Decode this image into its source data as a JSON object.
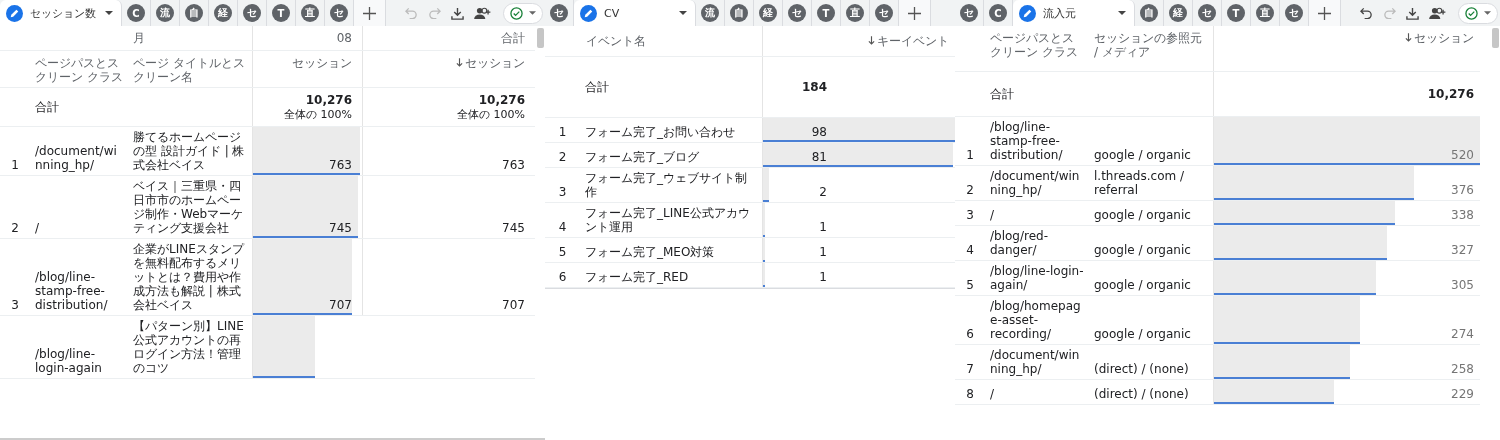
{
  "panels": [
    {
      "tabs": [
        {
          "label": "セッション数",
          "selected": true
        },
        {
          "label": "C",
          "selected": false
        },
        {
          "label": "流",
          "selected": false
        },
        {
          "label": "自",
          "selected": false
        },
        {
          "label": "経",
          "selected": false
        },
        {
          "label": "セ",
          "selected": false
        },
        {
          "label": "T",
          "selected": false
        },
        {
          "label": "直",
          "selected": false
        },
        {
          "label": "セ",
          "selected": false
        }
      ],
      "toolbar": {
        "undo": {
          "disabled": true
        },
        "redo": {
          "disabled": true
        }
      },
      "table": {
        "columns": [
          {
            "heading": "ページパスとスクリーン クラス",
            "kind": "dimension"
          },
          {
            "heading": "ページ タイトルとスクリーン名",
            "kind": "dimension",
            "group": "月"
          },
          {
            "heading": "セッション",
            "kind": "metric",
            "group": "08",
            "sorted": false
          },
          {
            "heading": "セッション",
            "kind": "metric",
            "group": "合計",
            "sorted": true
          }
        ],
        "total": {
          "label": "合計",
          "cells": [
            {
              "value": "10,276",
              "share": "全体の 100%"
            },
            {
              "value": "10,276",
              "share": "全体の 100%"
            }
          ]
        },
        "rows": [
          {
            "index": "1",
            "dims": [
              "/document/winning_hp/",
              "勝てるホームページの型 設計ガイド | 株式会社ベイス"
            ],
            "metrics": [
              {
                "value": "763",
                "level": 0.98
              },
              {
                "value": "763"
              }
            ]
          },
          {
            "index": "2",
            "dims": [
              "/",
              "ベイス｜三重県・四日市市のホームページ制作・Webマーケティング支援会社"
            ],
            "metrics": [
              {
                "value": "745",
                "level": 0.96
              },
              {
                "value": "745"
              }
            ]
          },
          {
            "index": "3",
            "dims": [
              "/blog/line-stamp-free-distribution/",
              "企業がLINEスタンプを無料配布するメリットとは？費用や作成方法も解説 | 株式会社ベイス"
            ],
            "metrics": [
              {
                "value": "707",
                "level": 0.91
              },
              {
                "value": "707"
              }
            ]
          },
          {
            "dims": [
              "/blog/line-login-again",
              "【パターン別】LINE公式アカウントの再ログイン方法！管理のコツ"
            ],
            "metrics": [
              {
                "level": 0.57
              }
            ]
          }
        ]
      }
    },
    {
      "tabs": [
        {
          "label": "セ",
          "selected": false
        },
        {
          "label": "CV",
          "selected": true
        },
        {
          "label": "流",
          "selected": false
        },
        {
          "label": "自",
          "selected": false
        },
        {
          "label": "経",
          "selected": false
        },
        {
          "label": "セ",
          "selected": false
        },
        {
          "label": "T",
          "selected": false
        },
        {
          "label": "直",
          "selected": false
        },
        {
          "label": "セ",
          "selected": false
        }
      ],
      "table": {
        "columns": [
          {
            "heading": "イベント名",
            "kind": "dimension"
          },
          {
            "heading": "キーイベント",
            "kind": "metric",
            "sorted": true
          }
        ],
        "total": {
          "label": "合計",
          "cells": [
            {
              "value": "184"
            }
          ]
        },
        "rows": [
          {
            "index": "1",
            "dims": [
              "フォーム完了_お問い合わせ"
            ],
            "metrics": [
              {
                "value": "98",
                "level": 1
              }
            ]
          },
          {
            "index": "2",
            "dims": [
              "フォーム完了_ブログ"
            ],
            "metrics": [
              {
                "value": "81",
                "level": 0.99
              }
            ]
          },
          {
            "index": "3",
            "dims": [
              "フォーム完了_ウェブサイト制作"
            ],
            "metrics": [
              {
                "value": "2",
                "level": 0.03
              }
            ]
          },
          {
            "index": "4",
            "dims": [
              "フォーム完了_LINE公式アカウント運用"
            ],
            "metrics": [
              {
                "value": "1",
                "level": 0.01
              }
            ]
          },
          {
            "index": "5",
            "dims": [
              "フォーム完了_MEO対策"
            ],
            "metrics": [
              {
                "value": "1",
                "level": 0.01
              }
            ]
          },
          {
            "index": "6",
            "dims": [
              "フォーム完了_RED"
            ],
            "metrics": [
              {
                "value": "1",
                "level": 0.01
              }
            ]
          }
        ]
      }
    },
    {
      "tabs": [
        {
          "label": "セ",
          "selected": false
        },
        {
          "label": "C",
          "selected": false
        },
        {
          "label": "流入元",
          "selected": true
        },
        {
          "label": "自",
          "selected": false
        },
        {
          "label": "経",
          "selected": false
        },
        {
          "label": "セ",
          "selected": false
        },
        {
          "label": "T",
          "selected": false
        },
        {
          "label": "直",
          "selected": false
        },
        {
          "label": "セ",
          "selected": false
        }
      ],
      "toolbar": {
        "undo": {
          "disabled": false
        },
        "redo": {
          "disabled": true
        }
      },
      "table": {
        "columns": [
          {
            "heading": "ページパスとスクリーン クラス",
            "kind": "dimension"
          },
          {
            "heading": "セッションの参照元 / メディア",
            "kind": "dimension"
          },
          {
            "heading": "セッション",
            "kind": "metric",
            "sorted": true
          }
        ],
        "total": {
          "label": "合計",
          "cells": [
            {
              "value": "10,276"
            }
          ]
        },
        "rows": [
          {
            "index": "1",
            "dims": [
              "/blog/line-stamp-free-distribution/",
              "google / organic"
            ],
            "metrics": [
              {
                "value": "520",
                "level": 1
              }
            ]
          },
          {
            "index": "2",
            "dims": [
              "/document/winning_hp/",
              "l.threads.com / referral"
            ],
            "metrics": [
              {
                "value": "376",
                "level": 0.75
              }
            ]
          },
          {
            "index": "3",
            "dims": [
              "/",
              "google / organic"
            ],
            "metrics": [
              {
                "value": "338",
                "level": 0.68
              }
            ]
          },
          {
            "index": "4",
            "dims": [
              "/blog/red-danger/",
              "google / organic"
            ],
            "metrics": [
              {
                "value": "327",
                "level": 0.65
              }
            ]
          },
          {
            "index": "5",
            "dims": [
              "/blog/line-login-again/",
              "google / organic"
            ],
            "metrics": [
              {
                "value": "305",
                "level": 0.61
              }
            ]
          },
          {
            "index": "6",
            "dims": [
              "/blog/homepage-asset-recording/",
              "google / organic"
            ],
            "metrics": [
              {
                "value": "274",
                "level": 0.55
              }
            ]
          },
          {
            "index": "7",
            "dims": [
              "/document/winning_hp/",
              "(direct) / (none)"
            ],
            "metrics": [
              {
                "value": "258",
                "level": 0.51
              }
            ]
          },
          {
            "index": "8",
            "dims": [
              "/",
              "(direct) / (none)"
            ],
            "metrics": [
              {
                "value": "229",
                "level": 0.45
              }
            ]
          }
        ]
      }
    }
  ]
}
